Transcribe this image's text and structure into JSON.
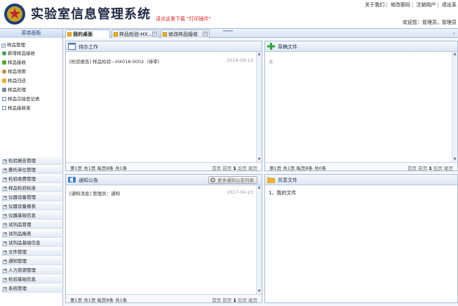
{
  "header": {
    "title": "实验室信息管理系统",
    "download_hint": "请点这里下载 \"打印插件\"",
    "links": [
      "关于我们",
      "修改密码",
      "注销用户",
      "退出系"
    ],
    "welcome": "欢迎您：管理员，管理员"
  },
  "tabs": {
    "menu_header": "菜单面板",
    "items": [
      {
        "label": "我的桌面"
      },
      {
        "label": "样品检验-HX..."
      },
      {
        "label": "修改样品接收"
      }
    ]
  },
  "sidebar": {
    "top_group": "样品管理",
    "items": [
      {
        "label": "新增样品接收",
        "icon": "add-icon"
      },
      {
        "label": "样品接收",
        "icon": "inbox-icon"
      },
      {
        "label": "样品领用",
        "icon": "user-icon"
      },
      {
        "label": "样品归还",
        "icon": "return-icon"
      },
      {
        "label": "样品处理",
        "icon": "process-icon"
      },
      {
        "label": "样品交接登记表",
        "icon": "form-icon"
      },
      {
        "label": "样品接收单",
        "icon": "form-icon"
      }
    ],
    "groups": [
      "检验报告管理",
      "委托单位管理",
      "检验收费管理",
      "样品检验标准",
      "仪器设备管理",
      "仪器设备报表",
      "仪器基础信息",
      "试剂品管理",
      "试剂品报表",
      "试剂品基础信息",
      "文件管理",
      "通知管理",
      "人力资源管理",
      "检验基础信息",
      "系统管理"
    ]
  },
  "panels": {
    "todo": {
      "title": "待办工作",
      "rows": [
        {
          "text": "[检验报告] 样品检验—HX018-0002（待审）",
          "date": "2018-09-13"
        }
      ],
      "footer_left": "第1页 共1页 每页8条 共1条",
      "footer_right": [
        "首页",
        "前页",
        "1",
        "后页",
        "尾页"
      ]
    },
    "drafts": {
      "title": "草稿文件",
      "empty": "无",
      "footer_left": "第1页 共1页 每页8条 共0条",
      "footer_right": [
        "首页",
        "前页",
        "1",
        "后页",
        "尾页"
      ]
    },
    "notice": {
      "title": "通知公告",
      "button": "更多通知公告列表",
      "rows": [
        {
          "text": "[通知消息] 管理员：通知",
          "date": "2017-04-23"
        }
      ],
      "footer_left": "第1页 共1页 每页8条 共1条",
      "footer_right": [
        "首页",
        "前页",
        "1",
        "后页",
        "尾页"
      ]
    },
    "shared": {
      "title": "共享文件",
      "rows": [
        {
          "text": "1、我的文件"
        }
      ]
    }
  },
  "colors": {
    "accent": "#2b4a7c",
    "hint": "#dd2222",
    "tab_icon": "#f0b520"
  }
}
